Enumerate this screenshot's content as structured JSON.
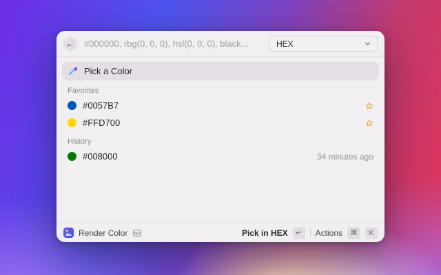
{
  "window": {
    "header": {
      "back_icon": "←",
      "search_placeholder": "#000000, rbg(0, 0, 0), hsl(0, 0, 0), black...",
      "dropdown": {
        "value": "HEX"
      }
    },
    "command": {
      "label": "Pick a Color"
    },
    "favorites": {
      "title": "Favorites",
      "rows": [
        {
          "label": "#0057B7",
          "swatch": "#0057B7",
          "starred": true
        },
        {
          "label": "#FFD700",
          "swatch": "#FFD700",
          "starred": true
        }
      ]
    },
    "history": {
      "title": "History",
      "rows": [
        {
          "label": "#008000",
          "swatch": "#008000",
          "meta": "34 minutes ago"
        }
      ]
    },
    "footer": {
      "app_name": "Render Color",
      "primary_action": "Pick in HEX",
      "primary_key": "↵",
      "actions_label": "Actions",
      "actions_keys": [
        "⌘",
        "K"
      ]
    }
  },
  "colors": {
    "star": "#F0A33F",
    "window_bg": "#f2eff2",
    "selected_row_bg": "#e4dfe4"
  }
}
